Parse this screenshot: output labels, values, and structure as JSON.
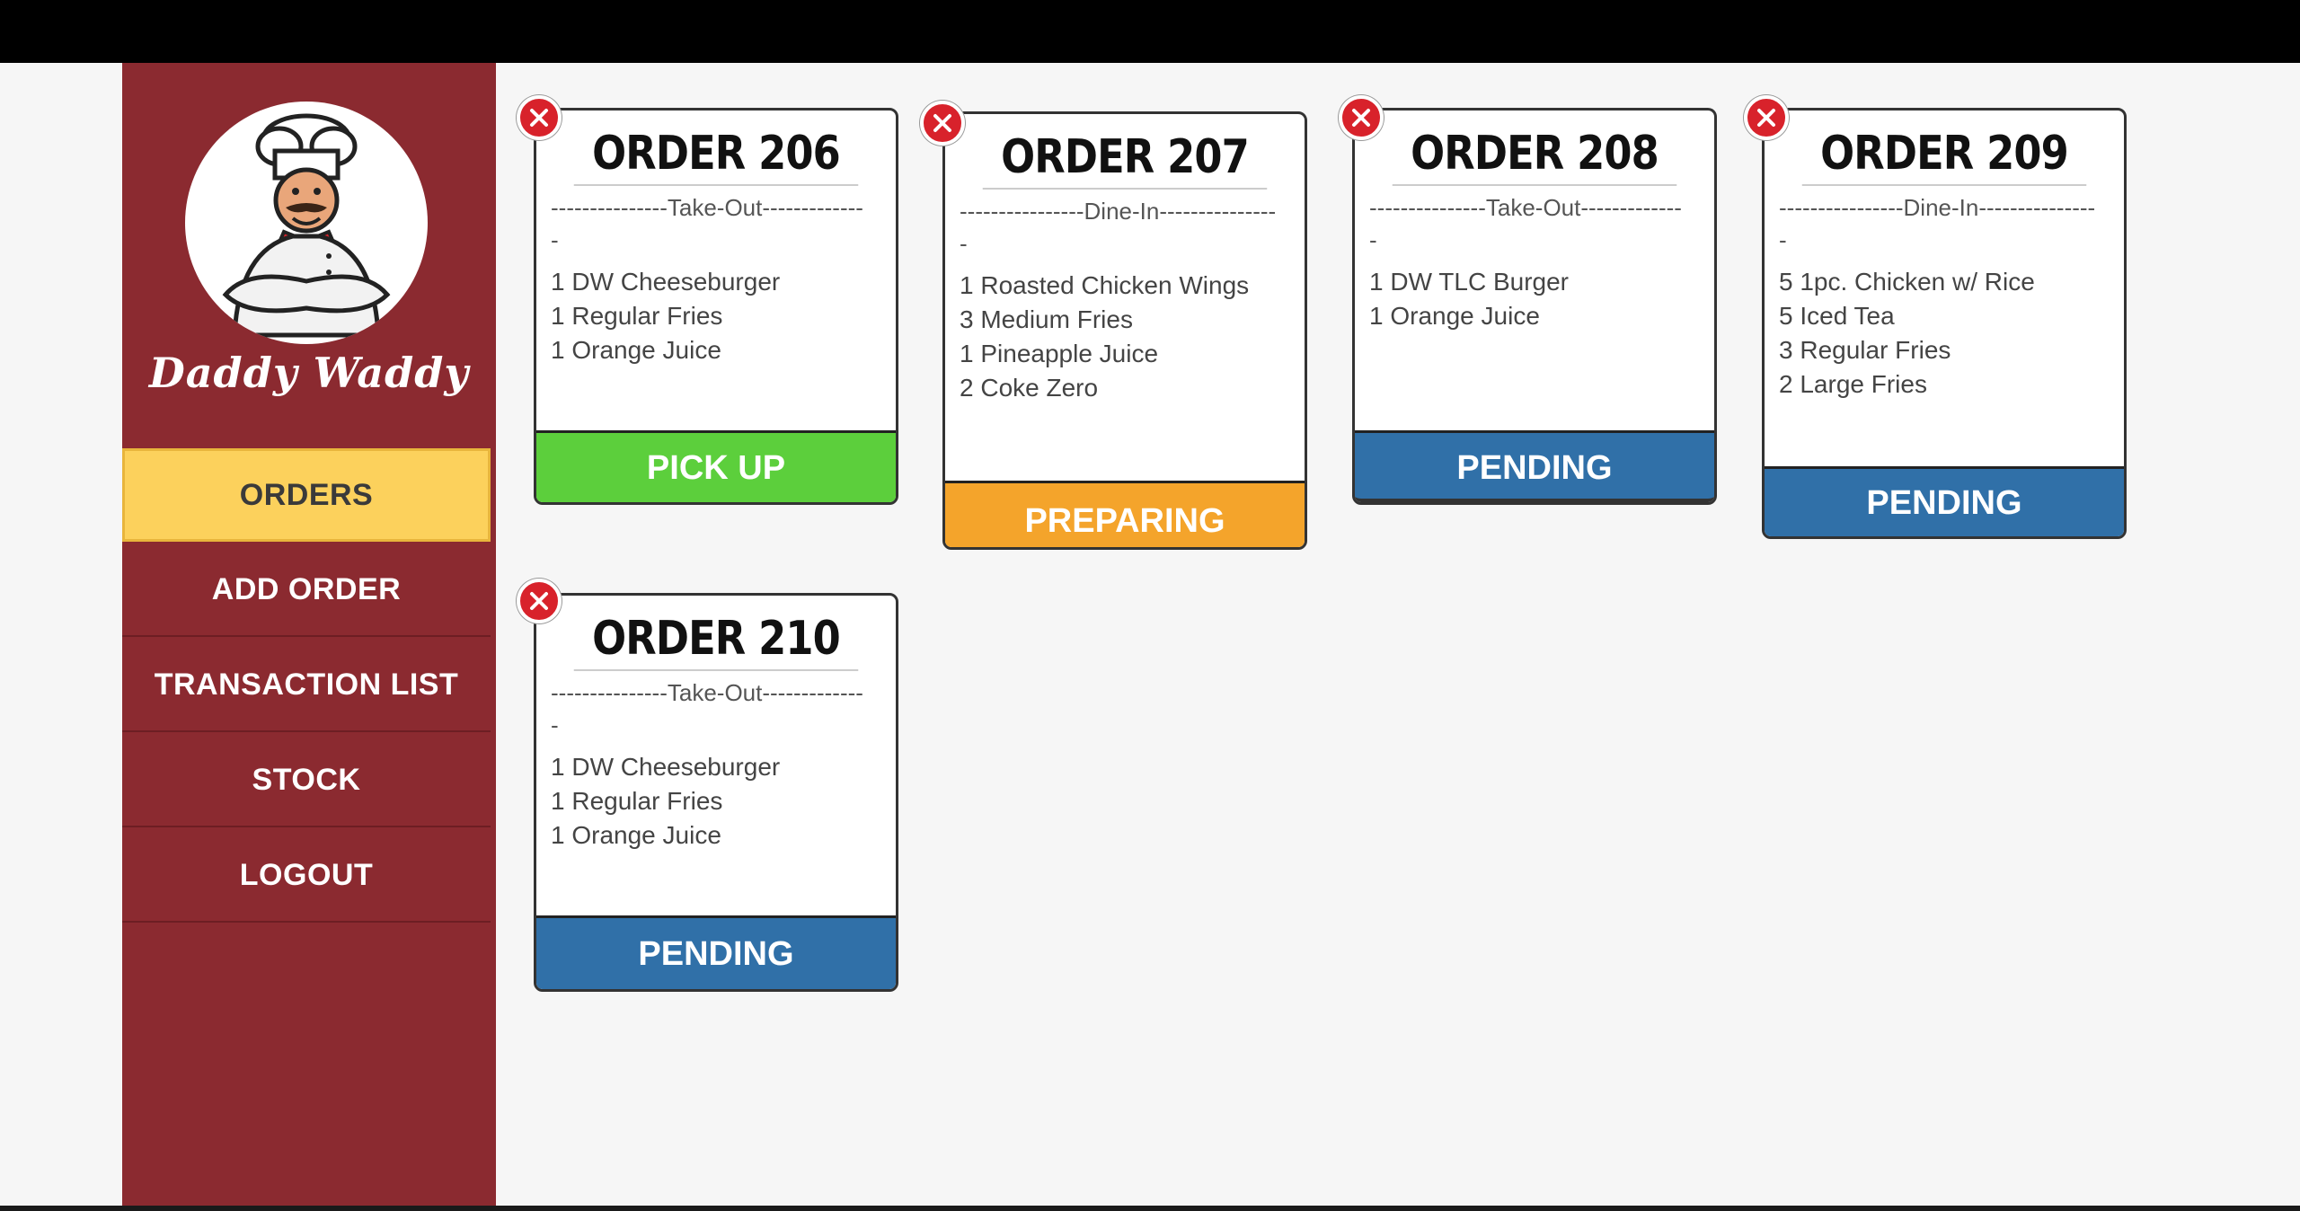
{
  "brand": {
    "name": "Daddy Waddy"
  },
  "nav": {
    "items": [
      {
        "label": "ORDERS",
        "active": true
      },
      {
        "label": "ADD ORDER",
        "active": false
      },
      {
        "label": "TRANSACTION LIST",
        "active": false
      },
      {
        "label": "STOCK",
        "active": false
      },
      {
        "label": "LOGOUT",
        "active": false
      }
    ]
  },
  "orders": [
    {
      "title": "ORDER 206",
      "type_line": "---------------Take-Out-------------",
      "type_tail": "-",
      "items": [
        "1 DW Cheeseburger",
        "1 Regular Fries",
        "1 Orange Juice"
      ],
      "status": "PICK UP",
      "status_color": "#5ccf3c"
    },
    {
      "title": "ORDER 207",
      "type_line": "----------------Dine-In---------------",
      "type_tail": "-",
      "items": [
        "1 Roasted Chicken Wings",
        "3 Medium Fries",
        "1 Pineapple Juice",
        "2 Coke Zero"
      ],
      "status": "PREPARING",
      "status_color": "#f4a42b"
    },
    {
      "title": "ORDER 208",
      "type_line": "---------------Take-Out-------------",
      "type_tail": "-",
      "items": [
        "1 DW TLC Burger",
        "1 Orange Juice"
      ],
      "status": "PENDING",
      "status_color": "#3070a8"
    },
    {
      "title": "ORDER 209",
      "type_line": "----------------Dine-In---------------",
      "type_tail": "-",
      "items": [
        "5 1pc. Chicken w/ Rice",
        "5 Iced Tea",
        "3 Regular Fries",
        "2 Large Fries"
      ],
      "status": "PENDING",
      "status_color": "#3070a8"
    },
    {
      "title": "ORDER 210",
      "type_line": "---------------Take-Out-------------",
      "type_tail": "-",
      "items": [
        "1 DW Cheeseburger",
        "1 Regular Fries",
        "1 Orange Juice"
      ],
      "status": "PENDING",
      "status_color": "#3070a8"
    }
  ],
  "colors": {
    "sidebar": "#8b2a30",
    "active_nav": "#fcd15c",
    "delete": "#d8222b"
  }
}
